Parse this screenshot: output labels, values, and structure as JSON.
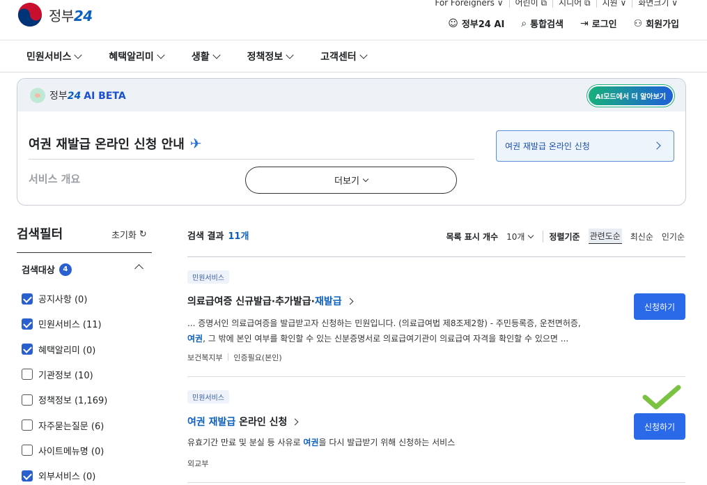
{
  "header": {
    "logo_text": "정부",
    "logo_num": "24",
    "util_links": [
      "For Foreigners ∨",
      "어린이 ⧉",
      "시니어 ⧉",
      "지원 ∨",
      "화면크기 ∨"
    ],
    "gnb": {
      "ai": "정부24 AI",
      "search": "통합검색",
      "login": "로그인",
      "signup": "회원가입"
    }
  },
  "menu": [
    "민원서비스",
    "혜택알리미",
    "생활",
    "정책정보",
    "고객센터"
  ],
  "ai_box": {
    "brand": "정부",
    "brand_num": "24",
    "ai_label": "AI BETA",
    "mode_button": "AI모드에서 더 알아보기",
    "question": "여권 재발급 온라인 신청 안내",
    "overview_label": "서비스 개요",
    "more_button": "더보기",
    "apply_link": "여권 재발급 온라인 신청"
  },
  "filter": {
    "title": "검색필터",
    "reset": "초기화",
    "target_label": "검색대상",
    "target_count": "4",
    "items": [
      {
        "label": "공지사항 (0)",
        "checked": true
      },
      {
        "label": "민원서비스 (11)",
        "checked": true
      },
      {
        "label": "혜택알리미 (0)",
        "checked": true
      },
      {
        "label": "기관정보 (10)",
        "checked": false
      },
      {
        "label": "정책정보 (1,169)",
        "checked": false
      },
      {
        "label": "자주묻는질문 (6)",
        "checked": false
      },
      {
        "label": "사이트메뉴명 (0)",
        "checked": false
      },
      {
        "label": "외부서비스 (0)",
        "checked": true
      }
    ]
  },
  "results": {
    "label": "검색 결과",
    "count": "11개",
    "per_page_label": "목록 표시 개수",
    "per_page_value": "10개",
    "sort_label": "정렬기준",
    "sort_options": [
      "관련도순",
      "최신순",
      "인기순"
    ],
    "items": [
      {
        "tag": "민원서비스",
        "title_pre": "의료급여증 신규발급·추가발급·",
        "title_hl": "재발급",
        "desc1": "... 증명서인 의료급여증을 발급받고자 신청하는 민원입니다. (의료급여법 제8조제2항) - 주민등록증, 운전면허증,",
        "desc2_hl": "여권",
        "desc2": ", 그 밖에 본인 여부를 확인할 수 있는 신분증명서로 의료급여기관이 의료급여 자격을 확인할 수 있으면 ...",
        "org": "보건복지부",
        "auth": "인증필요(본인)",
        "button": "신청하기"
      },
      {
        "tag": "민원서비스",
        "title_hl": "여권 재발급",
        "title_post": " 온라인 신청",
        "desc_pre": "유효기간 만료 및 분실 등 사유로 ",
        "desc_hl": "여권",
        "desc_post": "을 다시 발급받기 위해 신청하는 서비스",
        "org": "외교부",
        "button": "신청하기"
      }
    ]
  }
}
